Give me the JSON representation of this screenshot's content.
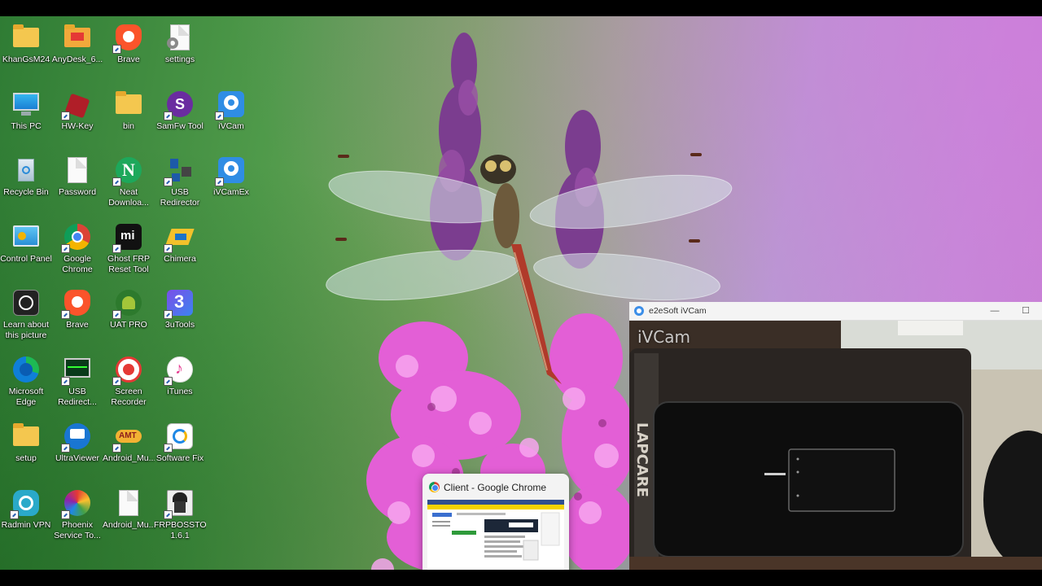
{
  "desktop": {
    "icons": [
      {
        "label": "KhanGsM24",
        "icon": "folder-icon"
      },
      {
        "label": "AnyDesk_6...",
        "icon": "anydesk-icon"
      },
      {
        "label": "Brave",
        "icon": "brave-icon"
      },
      {
        "label": "settings",
        "icon": "settings-file-icon"
      },
      {
        "label": "This PC",
        "icon": "monitor-icon"
      },
      {
        "label": "HW-Key",
        "icon": "hw-key-icon"
      },
      {
        "label": "bin",
        "icon": "folder-icon"
      },
      {
        "label": "SamFw Tool",
        "icon": "samfw-icon"
      },
      {
        "label": "iVCam",
        "icon": "ivcam-icon"
      },
      {
        "label": "Recycle Bin",
        "icon": "recycle-bin-icon"
      },
      {
        "label": "Password",
        "icon": "document-icon"
      },
      {
        "label": "Neat Downloa...",
        "icon": "neat-download-icon"
      },
      {
        "label": "USB Redirector",
        "icon": "usb-icon"
      },
      {
        "label": "iVCamEx",
        "icon": "ivcam-icon"
      },
      {
        "label": "Control Panel",
        "icon": "control-panel-icon"
      },
      {
        "label": "Google Chrome",
        "icon": "chrome-icon"
      },
      {
        "label": "Ghost FRP Reset Tool",
        "icon": "mi-icon"
      },
      {
        "label": "Chimera",
        "icon": "chimera-icon"
      },
      {
        "label": "Learn about this picture",
        "icon": "camera-icon"
      },
      {
        "label": "Brave",
        "icon": "brave-icon"
      },
      {
        "label": "UAT PRO",
        "icon": "android-icon"
      },
      {
        "label": "3uTools",
        "icon": "3utools-icon"
      },
      {
        "label": "Microsoft Edge",
        "icon": "edge-icon"
      },
      {
        "label": "USB Redirect...",
        "icon": "usb-monitor-icon"
      },
      {
        "label": "Screen Recorder",
        "icon": "record-icon"
      },
      {
        "label": "iTunes",
        "icon": "itunes-icon"
      },
      {
        "label": "setup",
        "icon": "folder-icon"
      },
      {
        "label": "UltraViewer",
        "icon": "ultraviewer-icon"
      },
      {
        "label": "Android_Mu...",
        "icon": "android-multitool-icon"
      },
      {
        "label": "Software Fix",
        "icon": "software-fix-icon"
      },
      {
        "label": "Radmin VPN",
        "icon": "radmin-icon"
      },
      {
        "label": "Phoenix Service To...",
        "icon": "phoenix-icon"
      },
      {
        "label": "Android_Mu...",
        "icon": "document-icon"
      },
      {
        "label": "FRPBOSSTO... 1.6.1",
        "icon": "frpboss-icon"
      }
    ]
  },
  "taskbar_preview": {
    "title": "Client - Google Chrome",
    "icon": "chrome-icon"
  },
  "ivcam_window": {
    "title": "e2eSoft iVCam",
    "watermark": "iVCam",
    "minimize": "—",
    "maximize": "☐"
  }
}
